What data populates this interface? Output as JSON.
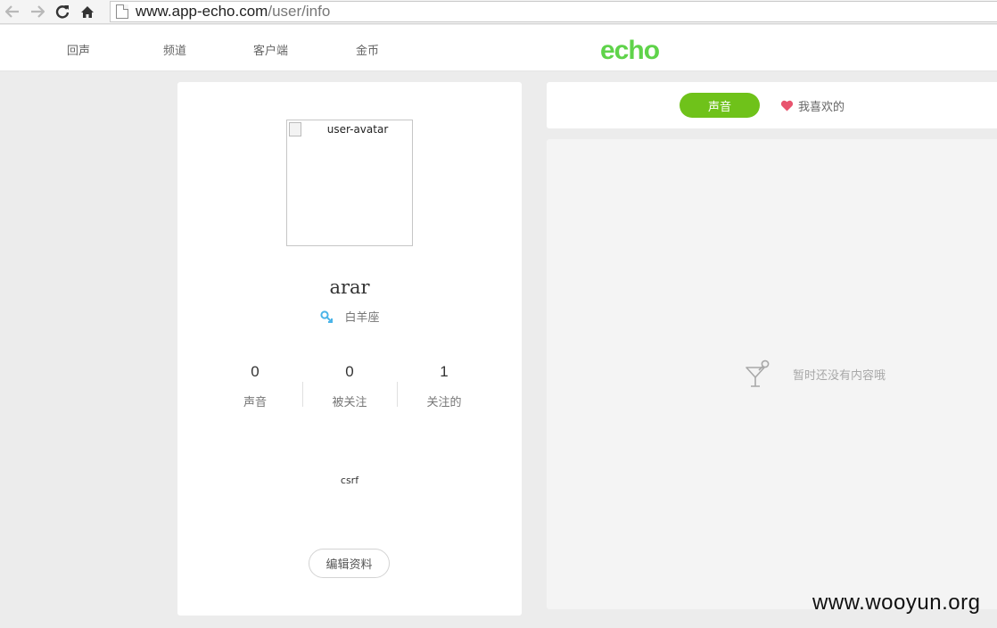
{
  "browser": {
    "url_host": "www.app-echo.com",
    "url_path": "/user/info",
    "back_icon": "arrow-left-icon",
    "forward_icon": "arrow-right-icon",
    "reload_icon": "reload-icon",
    "home_icon": "home-icon"
  },
  "header": {
    "nav": [
      "回声",
      "频道",
      "客户端",
      "金币"
    ],
    "logo": "echo",
    "brand_color": "#5fd34a"
  },
  "profile": {
    "avatar_alt": "user-avatar",
    "username": "arar",
    "zodiac": "白羊座",
    "stats": [
      {
        "value": "0",
        "label": "声音"
      },
      {
        "value": "0",
        "label": "被关注"
      },
      {
        "value": "1",
        "label": "关注的"
      }
    ],
    "bio": "csrf",
    "edit_label": "编辑资料"
  },
  "tabs": {
    "sound_label": "声音",
    "likes_label": "我喜欢的",
    "active_color": "#6fc21a"
  },
  "content": {
    "empty_text": "暂时还没有内容哦"
  },
  "watermark": "www.wooyun.org"
}
